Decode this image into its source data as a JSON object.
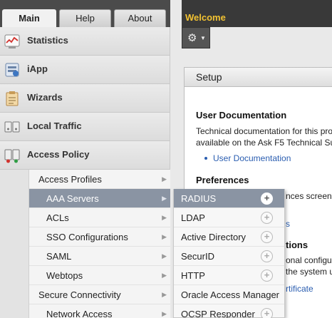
{
  "tabs": {
    "main": "Main",
    "help": "Help",
    "about": "About"
  },
  "sidebar": {
    "sections": [
      {
        "label": "Statistics",
        "icon": "statistics-icon"
      },
      {
        "label": "iApp",
        "icon": "iapp-icon"
      },
      {
        "label": "Wizards",
        "icon": "wizards-icon"
      },
      {
        "label": "Local Traffic",
        "icon": "local-traffic-icon"
      },
      {
        "label": "Access Policy",
        "icon": "access-policy-icon"
      }
    ],
    "submenu": [
      "Access Profiles",
      "AAA Servers",
      "ACLs",
      "SSO Configurations",
      "SAML",
      "Webtops",
      "Secure Connectivity",
      "Network Access"
    ],
    "selected_sub": "AAA Servers"
  },
  "flyout": {
    "items": [
      "RADIUS",
      "LDAP",
      "Active Directory",
      "SecurID",
      "HTTP",
      "Oracle Access Manager",
      "OCSP Responder"
    ],
    "selected": "RADIUS"
  },
  "header": {
    "welcome": "Welcome"
  },
  "setup": {
    "title": "Setup",
    "user_doc_heading": "User Documentation",
    "user_doc_line1": "Technical documentation for this pro",
    "user_doc_line2": "available on the Ask F5 Technical Su",
    "user_doc_link": "User Documentation",
    "prefs_heading": "Preferences",
    "prefs_line": "nces screen,",
    "prefs_link": "s",
    "tions_heading": "tions",
    "tions_line1": "onal configu",
    "tions_line2": "the system u",
    "cert_link": "rtificate"
  },
  "colors": {
    "welcome": "#f2c232",
    "selected_row": "#8a94a3",
    "link": "#2a5db0"
  }
}
